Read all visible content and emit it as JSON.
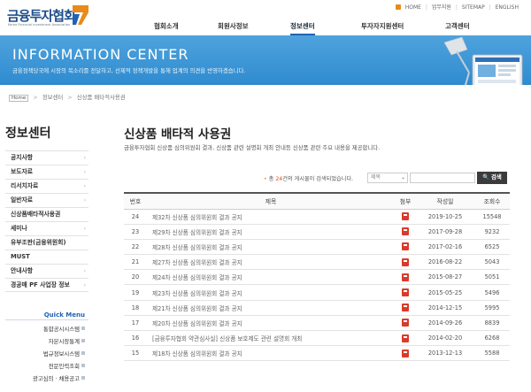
{
  "logo": {
    "text_kr": "금융투자협회",
    "text_en": "Korea Financial Investment Association"
  },
  "util_links": [
    "HOME",
    "업무지원",
    "SITEMAP",
    "ENGLISH"
  ],
  "gnb": [
    "협회소개",
    "회원사정보",
    "정보센터",
    "투자자지원센터",
    "고객센터"
  ],
  "gnb_active_index": 2,
  "banner": {
    "title": "INFORMATION CENTER",
    "subtitle": "금융정책당국에 시장의 목소리를 전달하고, 선제적 정책개발을 통해 업계의 의견을 반영하겠습니다."
  },
  "breadcrumb": [
    "Home",
    "정보센터",
    "신상품 배타적사용권"
  ],
  "sidebar": {
    "title": "정보센터",
    "items": [
      "공지사항",
      "보도자료",
      "리서치자료",
      "일반자료",
      "신상품배타적사용권",
      "세미나",
      "유부조판(금융위원회)",
      "MUST",
      "안내사항",
      "경공매 PF 사업장 정보"
    ],
    "quick_menu_title": "Quick Menu",
    "quick_items": [
      "통합공시시스템",
      "자본시장통계",
      "법규정보시스템",
      "전문인력조회",
      "광고심의 · 채용공고"
    ]
  },
  "main": {
    "title": "신상품 배타적 사용권",
    "description": "금융투자협회 신상품 심의위원회 결과, 신상품 관련 설명회 개최 안내등 신상품 관련 주요 내용을 제공합니다.",
    "count_prefix": "총",
    "count": "24",
    "count_suffix": "건의 게시물이 검색되었습니다.",
    "search_select": "제목",
    "search_value": "",
    "search_button": "검색"
  },
  "table": {
    "headers": [
      "번호",
      "제목",
      "첨부",
      "작성일",
      "조회수"
    ],
    "rows": [
      {
        "no": "24",
        "title": "제32차 신상품 심의위원회 결과 공지",
        "date": "2019-10-25",
        "views": "15548"
      },
      {
        "no": "23",
        "title": "제29차 신상품 심의위원회 결과 공지",
        "date": "2017-09-28",
        "views": "9232"
      },
      {
        "no": "22",
        "title": "제28차 신상품 심의위원회 결과 공지",
        "date": "2017-02-16",
        "views": "6525"
      },
      {
        "no": "21",
        "title": "제27차 신상품 심의위원회 결과 공지",
        "date": "2016-08-22",
        "views": "5043"
      },
      {
        "no": "20",
        "title": "제24차 신상품 심의위원회 결과 공지",
        "date": "2015-08-27",
        "views": "5051"
      },
      {
        "no": "19",
        "title": "제23차 신상품 심의위원회 결과 공지",
        "date": "2015-05-25",
        "views": "5496"
      },
      {
        "no": "18",
        "title": "제21차 신상품 심의위원회 결과 공지",
        "date": "2014-12-15",
        "views": "5995"
      },
      {
        "no": "17",
        "title": "제20차 신상품 심의위원회 결과 공지",
        "date": "2014-09-26",
        "views": "8839"
      },
      {
        "no": "16",
        "title": "[금융투자협회 약관심사실] 신상품 보호제도 관련 설명회 개최",
        "date": "2014-02-20",
        "views": "6268"
      },
      {
        "no": "15",
        "title": "제18차 신상품 심의위원회 결과 공지",
        "date": "2013-12-13",
        "views": "5588"
      }
    ]
  },
  "colors": {
    "accent": "#1f63b5",
    "banner": "#3b96d6",
    "pdf": "#d93a2b",
    "count": "#e04a1a"
  }
}
